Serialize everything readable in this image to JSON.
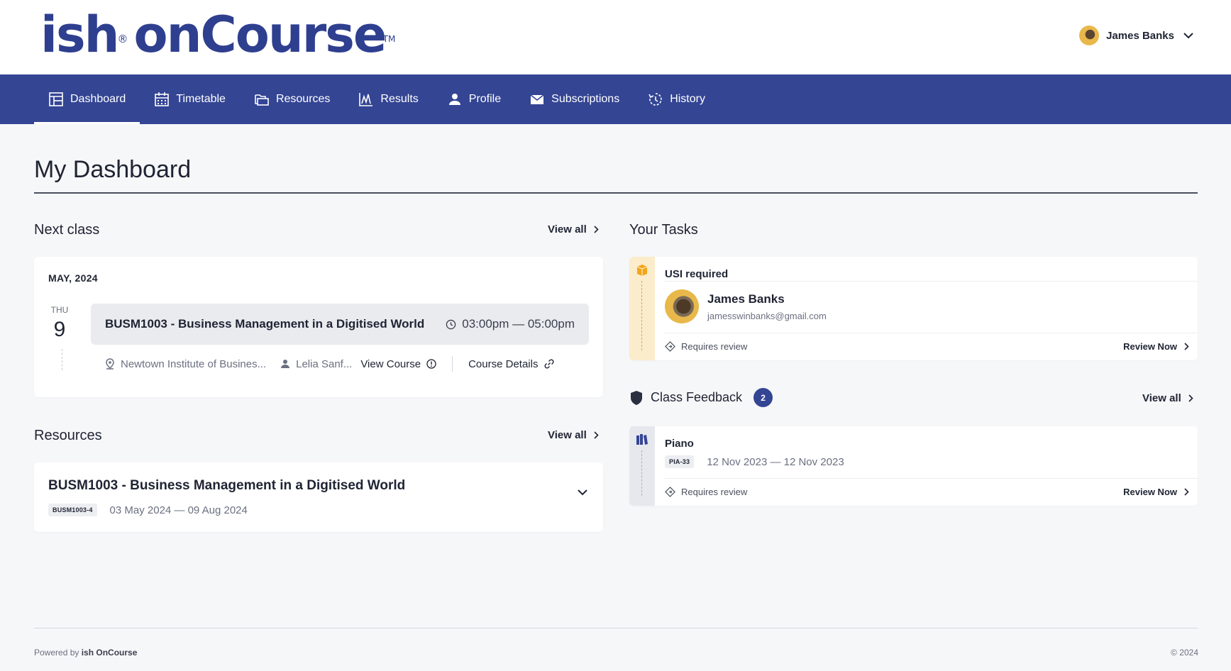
{
  "brand": {
    "logo_ish": "ish",
    "logo_oncourse": "onCourse",
    "reg_mark": "®",
    "tm_mark": "TM"
  },
  "user": {
    "name": "James Banks"
  },
  "nav": [
    {
      "label": "Dashboard",
      "icon": "dashboard-icon",
      "active": true
    },
    {
      "label": "Timetable",
      "icon": "calendar-icon"
    },
    {
      "label": "Resources",
      "icon": "folders-icon"
    },
    {
      "label": "Results",
      "icon": "chart-icon"
    },
    {
      "label": "Profile",
      "icon": "person-icon"
    },
    {
      "label": "Subscriptions",
      "icon": "mail-icon"
    },
    {
      "label": "History",
      "icon": "history-icon"
    }
  ],
  "page": {
    "title": "My Dashboard"
  },
  "next_class": {
    "title": "Next class",
    "view_all": "View all",
    "month": "MAY, 2024",
    "day_of_week": "THU",
    "day_number": "9",
    "course_name": "BUSM1003 - Business Management in a Digitised World",
    "time": "03:00pm — 05:00pm",
    "location": "Newtown Institute of Busines...",
    "tutor": "Lelia Sanf...",
    "view_course": "View Course",
    "course_details": "Course Details"
  },
  "resources": {
    "title": "Resources",
    "view_all": "View all",
    "course_name": "BUSM1003 - Business Management in a Digitised World",
    "code": "BUSM1003-4",
    "dates": "03 May 2024 — 09 Aug 2024"
  },
  "tasks": {
    "title": "Your Tasks",
    "usi": {
      "label": "USI required",
      "name": "James Banks",
      "email": "jamesswinbanks@gmail.com",
      "status": "Requires review",
      "action": "Review Now",
      "accent": "#fbeccb"
    }
  },
  "class_feedback": {
    "title": "Class Feedback",
    "count": "2",
    "view_all": "View all",
    "item": {
      "name": "Piano",
      "code": "PIA-33",
      "dates": "12 Nov 2023 — 12 Nov 2023",
      "status": "Requires review",
      "action": "Review Now",
      "accent": "#e6e8ee"
    }
  },
  "footer": {
    "powered_prefix": "Powered by",
    "powered_brand": "ish OnCourse",
    "copyright": "© 2024"
  },
  "colors": {
    "primary": "#344594",
    "logo": "#2f3f8f",
    "task_amber": "#f2a51a"
  }
}
